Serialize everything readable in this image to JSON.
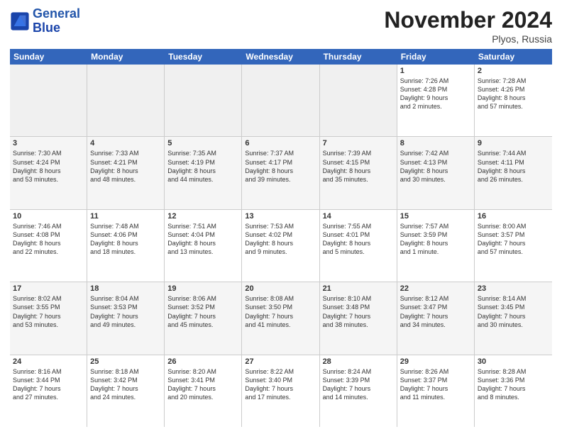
{
  "header": {
    "logo_line1": "General",
    "logo_line2": "Blue",
    "month_title": "November 2024",
    "location": "Plyos, Russia"
  },
  "days_of_week": [
    "Sunday",
    "Monday",
    "Tuesday",
    "Wednesday",
    "Thursday",
    "Friday",
    "Saturday"
  ],
  "weeks": [
    [
      {
        "day": "",
        "text": "",
        "empty": true
      },
      {
        "day": "",
        "text": "",
        "empty": true
      },
      {
        "day": "",
        "text": "",
        "empty": true
      },
      {
        "day": "",
        "text": "",
        "empty": true
      },
      {
        "day": "",
        "text": "",
        "empty": true
      },
      {
        "day": "1",
        "text": "Sunrise: 7:26 AM\nSunset: 4:28 PM\nDaylight: 9 hours\nand 2 minutes.",
        "empty": false
      },
      {
        "day": "2",
        "text": "Sunrise: 7:28 AM\nSunset: 4:26 PM\nDaylight: 8 hours\nand 57 minutes.",
        "empty": false
      }
    ],
    [
      {
        "day": "3",
        "text": "Sunrise: 7:30 AM\nSunset: 4:24 PM\nDaylight: 8 hours\nand 53 minutes.",
        "empty": false
      },
      {
        "day": "4",
        "text": "Sunrise: 7:33 AM\nSunset: 4:21 PM\nDaylight: 8 hours\nand 48 minutes.",
        "empty": false
      },
      {
        "day": "5",
        "text": "Sunrise: 7:35 AM\nSunset: 4:19 PM\nDaylight: 8 hours\nand 44 minutes.",
        "empty": false
      },
      {
        "day": "6",
        "text": "Sunrise: 7:37 AM\nSunset: 4:17 PM\nDaylight: 8 hours\nand 39 minutes.",
        "empty": false
      },
      {
        "day": "7",
        "text": "Sunrise: 7:39 AM\nSunset: 4:15 PM\nDaylight: 8 hours\nand 35 minutes.",
        "empty": false
      },
      {
        "day": "8",
        "text": "Sunrise: 7:42 AM\nSunset: 4:13 PM\nDaylight: 8 hours\nand 30 minutes.",
        "empty": false
      },
      {
        "day": "9",
        "text": "Sunrise: 7:44 AM\nSunset: 4:11 PM\nDaylight: 8 hours\nand 26 minutes.",
        "empty": false
      }
    ],
    [
      {
        "day": "10",
        "text": "Sunrise: 7:46 AM\nSunset: 4:08 PM\nDaylight: 8 hours\nand 22 minutes.",
        "empty": false
      },
      {
        "day": "11",
        "text": "Sunrise: 7:48 AM\nSunset: 4:06 PM\nDaylight: 8 hours\nand 18 minutes.",
        "empty": false
      },
      {
        "day": "12",
        "text": "Sunrise: 7:51 AM\nSunset: 4:04 PM\nDaylight: 8 hours\nand 13 minutes.",
        "empty": false
      },
      {
        "day": "13",
        "text": "Sunrise: 7:53 AM\nSunset: 4:02 PM\nDaylight: 8 hours\nand 9 minutes.",
        "empty": false
      },
      {
        "day": "14",
        "text": "Sunrise: 7:55 AM\nSunset: 4:01 PM\nDaylight: 8 hours\nand 5 minutes.",
        "empty": false
      },
      {
        "day": "15",
        "text": "Sunrise: 7:57 AM\nSunset: 3:59 PM\nDaylight: 8 hours\nand 1 minute.",
        "empty": false
      },
      {
        "day": "16",
        "text": "Sunrise: 8:00 AM\nSunset: 3:57 PM\nDaylight: 7 hours\nand 57 minutes.",
        "empty": false
      }
    ],
    [
      {
        "day": "17",
        "text": "Sunrise: 8:02 AM\nSunset: 3:55 PM\nDaylight: 7 hours\nand 53 minutes.",
        "empty": false
      },
      {
        "day": "18",
        "text": "Sunrise: 8:04 AM\nSunset: 3:53 PM\nDaylight: 7 hours\nand 49 minutes.",
        "empty": false
      },
      {
        "day": "19",
        "text": "Sunrise: 8:06 AM\nSunset: 3:52 PM\nDaylight: 7 hours\nand 45 minutes.",
        "empty": false
      },
      {
        "day": "20",
        "text": "Sunrise: 8:08 AM\nSunset: 3:50 PM\nDaylight: 7 hours\nand 41 minutes.",
        "empty": false
      },
      {
        "day": "21",
        "text": "Sunrise: 8:10 AM\nSunset: 3:48 PM\nDaylight: 7 hours\nand 38 minutes.",
        "empty": false
      },
      {
        "day": "22",
        "text": "Sunrise: 8:12 AM\nSunset: 3:47 PM\nDaylight: 7 hours\nand 34 minutes.",
        "empty": false
      },
      {
        "day": "23",
        "text": "Sunrise: 8:14 AM\nSunset: 3:45 PM\nDaylight: 7 hours\nand 30 minutes.",
        "empty": false
      }
    ],
    [
      {
        "day": "24",
        "text": "Sunrise: 8:16 AM\nSunset: 3:44 PM\nDaylight: 7 hours\nand 27 minutes.",
        "empty": false
      },
      {
        "day": "25",
        "text": "Sunrise: 8:18 AM\nSunset: 3:42 PM\nDaylight: 7 hours\nand 24 minutes.",
        "empty": false
      },
      {
        "day": "26",
        "text": "Sunrise: 8:20 AM\nSunset: 3:41 PM\nDaylight: 7 hours\nand 20 minutes.",
        "empty": false
      },
      {
        "day": "27",
        "text": "Sunrise: 8:22 AM\nSunset: 3:40 PM\nDaylight: 7 hours\nand 17 minutes.",
        "empty": false
      },
      {
        "day": "28",
        "text": "Sunrise: 8:24 AM\nSunset: 3:39 PM\nDaylight: 7 hours\nand 14 minutes.",
        "empty": false
      },
      {
        "day": "29",
        "text": "Sunrise: 8:26 AM\nSunset: 3:37 PM\nDaylight: 7 hours\nand 11 minutes.",
        "empty": false
      },
      {
        "day": "30",
        "text": "Sunrise: 8:28 AM\nSunset: 3:36 PM\nDaylight: 7 hours\nand 8 minutes.",
        "empty": false
      }
    ]
  ]
}
